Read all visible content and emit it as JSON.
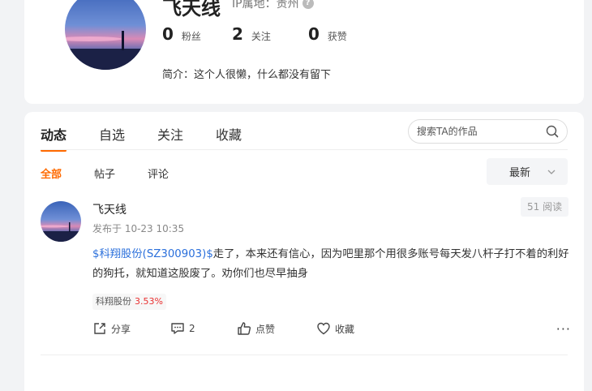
{
  "profile": {
    "name": "飞天线",
    "ip_location": "IP属地：贵州",
    "help_icon": "?",
    "stats": [
      {
        "value": "0",
        "label": "粉丝"
      },
      {
        "value": "2",
        "label": "关注"
      },
      {
        "value": "0",
        "label": "获赞"
      }
    ],
    "bio": "简介：这个人很懒，什么都没有留下"
  },
  "tabs": [
    {
      "label": "动态",
      "active": true
    },
    {
      "label": "自选",
      "active": false
    },
    {
      "label": "关注",
      "active": false
    },
    {
      "label": "收藏",
      "active": false
    }
  ],
  "search": {
    "placeholder": "搜索TA的作品",
    "icon": "search-icon"
  },
  "subtabs": [
    {
      "label": "全部",
      "active": true
    },
    {
      "label": "帖子",
      "active": false
    },
    {
      "label": "评论",
      "active": false
    }
  ],
  "sort": {
    "label": "最新",
    "icon": "chevron-down-icon"
  },
  "post": {
    "author": "飞天线",
    "time": "发布于 10-23 10:35",
    "reads": "51 阅读",
    "stock_link": "$科翔股份(SZ300903)$",
    "text": "走了，本来还有信心，因为吧里那个用很多账号每天发八杆子打不着的利好的狗托，就知道这股废了。劝你们也尽早抽身",
    "stock_tag": {
      "name": "科翔股份",
      "change": "3.53%"
    },
    "actions": {
      "share": "分享",
      "comment": "2",
      "like": "点赞",
      "collect": "收藏",
      "more": "···"
    }
  },
  "colors": {
    "accent": "#ff6a00",
    "link": "#2a6fdb",
    "up": "#e93030"
  }
}
